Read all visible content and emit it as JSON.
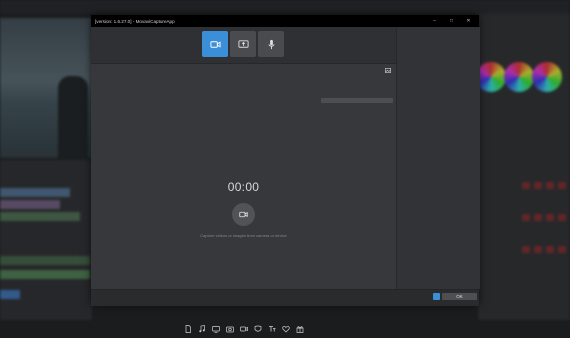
{
  "window": {
    "title": "[version: 1.6.27.0] - MovaviCaptureApp",
    "controls": {
      "minimize": "–",
      "maximize": "□",
      "close": "✕"
    }
  },
  "modes": [
    {
      "id": "video",
      "icon": "video-camera-icon",
      "active": true
    },
    {
      "id": "screen",
      "icon": "screen-capture-icon",
      "active": false
    },
    {
      "id": "audio",
      "icon": "microphone-icon",
      "active": false
    }
  ],
  "recorder": {
    "timer": "00:00",
    "hint": "Capture videos or images from camera or device"
  },
  "effects": [
    {
      "icon": "document-icon"
    },
    {
      "icon": "music-note-icon"
    },
    {
      "icon": "monitor-icon"
    },
    {
      "icon": "camera-icon"
    },
    {
      "icon": "video-camera-icon"
    },
    {
      "icon": "mask-icon"
    },
    {
      "icon": "text-title-icon"
    },
    {
      "icon": "hearts-icon"
    },
    {
      "icon": "gift-icon"
    }
  ],
  "footer": {
    "ok_label": "OK"
  },
  "colors": {
    "accent": "#3b8ed8",
    "window_bg": "#2f3033",
    "canvas_bg": "#37383b"
  }
}
